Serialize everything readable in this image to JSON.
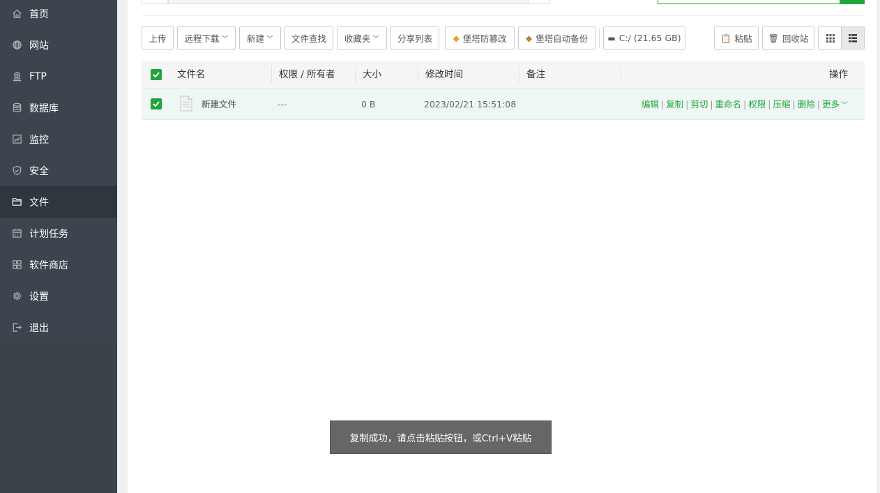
{
  "sidebar": {
    "items": [
      {
        "label": "首页",
        "icon": "home-icon",
        "active": false
      },
      {
        "label": "网站",
        "icon": "globe-icon",
        "active": false
      },
      {
        "label": "FTP",
        "icon": "ftp-icon",
        "active": false
      },
      {
        "label": "数据库",
        "icon": "database-icon",
        "active": false
      },
      {
        "label": "监控",
        "icon": "monitor-icon",
        "active": false
      },
      {
        "label": "安全",
        "icon": "shield-icon",
        "active": false
      },
      {
        "label": "文件",
        "icon": "folder-icon",
        "active": true
      },
      {
        "label": "计划任务",
        "icon": "calendar-icon",
        "active": false
      },
      {
        "label": "软件商店",
        "icon": "apps-icon",
        "active": false
      },
      {
        "label": "设置",
        "icon": "gear-icon",
        "active": false
      },
      {
        "label": "退出",
        "icon": "logout-icon",
        "active": false
      }
    ]
  },
  "toolbar": {
    "upload": "上传",
    "remote_download": "远程下载",
    "new": "新建",
    "file_search": "文件查找",
    "favorites": "收藏夹",
    "share_list": "分享列表",
    "tamper_proof": "堡塔防篡改",
    "auto_backup": "堡塔自动备份",
    "disk": "C:/ (21.65 GB)",
    "paste": "粘贴",
    "recycle_bin": "回收站"
  },
  "table": {
    "headers": {
      "name": "文件名",
      "permission": "权限 / 所有者",
      "size": "大小",
      "mtime": "修改时间",
      "remark": "备注",
      "ops": "操作"
    },
    "rows": [
      {
        "name": "新建文件",
        "permission": "---",
        "size": "0 B",
        "mtime": "2023/02/21 15:51:08",
        "remark": "",
        "selected": true
      }
    ],
    "row_ops": [
      "编辑",
      "复制",
      "剪切",
      "重命名",
      "权限",
      "压缩",
      "删除",
      "更多"
    ]
  },
  "toast": {
    "message": "复制成功，请点击粘贴按钮，或Ctrl+V粘贴"
  },
  "colors": {
    "accent": "#20a53a",
    "sidebar_bg": "#3c444d",
    "sidebar_active": "#2f363d",
    "toast_bg": "#666666"
  }
}
